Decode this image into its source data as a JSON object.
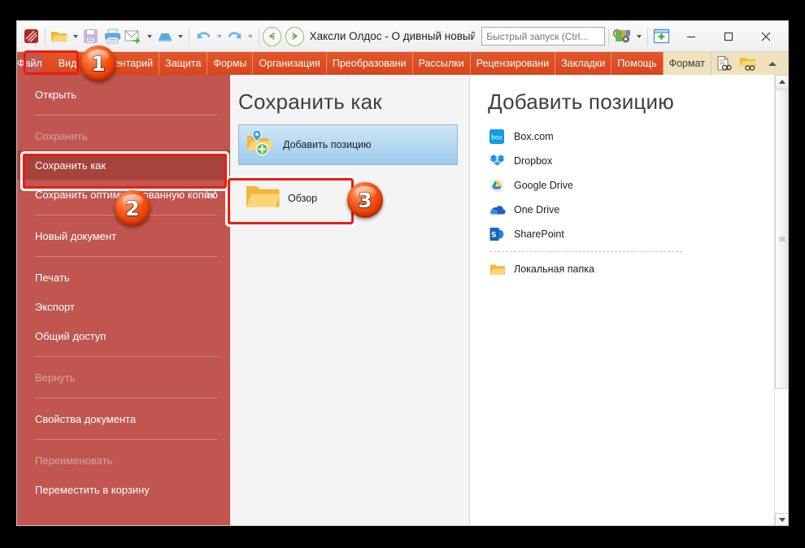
{
  "window": {
    "doc_title": "Хаксли Олдос - О дивный новый ..",
    "quick_search_placeholder": "Быстрый запуск (Ctrl...",
    "quick_search_value": "",
    "minimize_label": "—",
    "maximize_label": "□",
    "close_label": "✕"
  },
  "toolbar": {
    "items": [
      {
        "name": "app-logo-icon",
        "label": "PDFelement"
      },
      {
        "name": "open-file-icon",
        "label": "Открыть"
      },
      {
        "name": "save-icon",
        "label": "Сохранить"
      },
      {
        "name": "print-icon",
        "label": "Печать"
      },
      {
        "name": "email-icon",
        "label": "Отправить по почте"
      },
      {
        "name": "scan-icon",
        "label": "Сканировать"
      },
      {
        "name": "undo-icon",
        "label": "Отменить"
      },
      {
        "name": "redo-icon",
        "label": "Вернуть"
      },
      {
        "name": "back-icon",
        "label": "Назад"
      },
      {
        "name": "forward-icon",
        "label": "Вперёд"
      },
      {
        "name": "search-icon",
        "label": "Поиск"
      },
      {
        "name": "theme-settings-icon",
        "label": "Настройки"
      },
      {
        "name": "fullscreen-icon",
        "label": "Во весь экран"
      }
    ]
  },
  "menubar": {
    "file_label": "Файл",
    "tabs": [
      {
        "label": "Вид",
        "active": false
      },
      {
        "label": "Комментарий",
        "active": false
      },
      {
        "label": "Защита",
        "active": false
      },
      {
        "label": "Формы",
        "active": false
      },
      {
        "label": "Организация",
        "active": false
      },
      {
        "label": "Преобразовани",
        "active": false
      },
      {
        "label": "Рассылки",
        "active": false
      },
      {
        "label": "Рецензировани",
        "active": false
      },
      {
        "label": "Закладки",
        "active": false
      },
      {
        "label": "Помощь",
        "active": false
      },
      {
        "label": "Формат",
        "active": true
      }
    ],
    "right_icons": [
      {
        "name": "find-in-document-icon",
        "label": "Найти в документе"
      },
      {
        "name": "find-in-folder-icon",
        "label": "Найти в папке"
      },
      {
        "name": "collapse-ribbon-icon",
        "label": "Свернуть ленту"
      }
    ]
  },
  "sidebar": {
    "items": [
      {
        "label": "Открыть",
        "state": "normal",
        "trailing": null
      },
      {
        "type": "separator"
      },
      {
        "label": "Сохранить",
        "state": "disabled",
        "trailing": null
      },
      {
        "label": "Сохранить как",
        "state": "selected",
        "trailing": null
      },
      {
        "label": "Сохранить оптимизированную копию",
        "state": "normal",
        "trailing": "cart-icon"
      },
      {
        "type": "separator"
      },
      {
        "label": "Новый документ",
        "state": "normal",
        "trailing": null
      },
      {
        "type": "separator"
      },
      {
        "label": "Печать",
        "state": "normal",
        "trailing": null
      },
      {
        "label": "Экспорт",
        "state": "normal",
        "trailing": null
      },
      {
        "label": "Общий доступ",
        "state": "normal",
        "trailing": null
      },
      {
        "type": "separator"
      },
      {
        "label": "Вернуть",
        "state": "disabled",
        "trailing": null
      },
      {
        "type": "separator"
      },
      {
        "label": "Свойства документа",
        "state": "normal",
        "trailing": null
      },
      {
        "type": "separator"
      },
      {
        "label": "Переименовать",
        "state": "disabled",
        "trailing": null
      },
      {
        "label": "Переместить в корзину",
        "state": "normal",
        "trailing": null
      }
    ]
  },
  "midpanel": {
    "heading": "Сохранить как",
    "add_place_label": "Добавить позицию",
    "browse_label": "Обзор"
  },
  "rightpanel": {
    "heading": "Добавить позицию",
    "services": [
      {
        "label": "Box.com",
        "icon": "box-icon"
      },
      {
        "label": "Dropbox",
        "icon": "dropbox-icon"
      },
      {
        "label": "Google Drive",
        "icon": "google-drive-icon"
      },
      {
        "label": "One Drive",
        "icon": "onedrive-icon"
      },
      {
        "label": "SharePoint",
        "icon": "sharepoint-icon"
      }
    ],
    "local_folder_label": "Локальная папка",
    "local_folder_icon": "folder-icon"
  },
  "annotations": {
    "badges": [
      {
        "number": "1",
        "target": "file-menu-button"
      },
      {
        "number": "2",
        "target": "sidebar-item-save-as"
      },
      {
        "number": "3",
        "target": "browse-tile"
      }
    ]
  },
  "colors": {
    "ribbon_orange": "#de4f21",
    "sidebar_red": "#c0564f",
    "sidebar_selected": "#a8423c",
    "active_tab": "#efe2bd",
    "annotation_red": "#f01b0e"
  }
}
